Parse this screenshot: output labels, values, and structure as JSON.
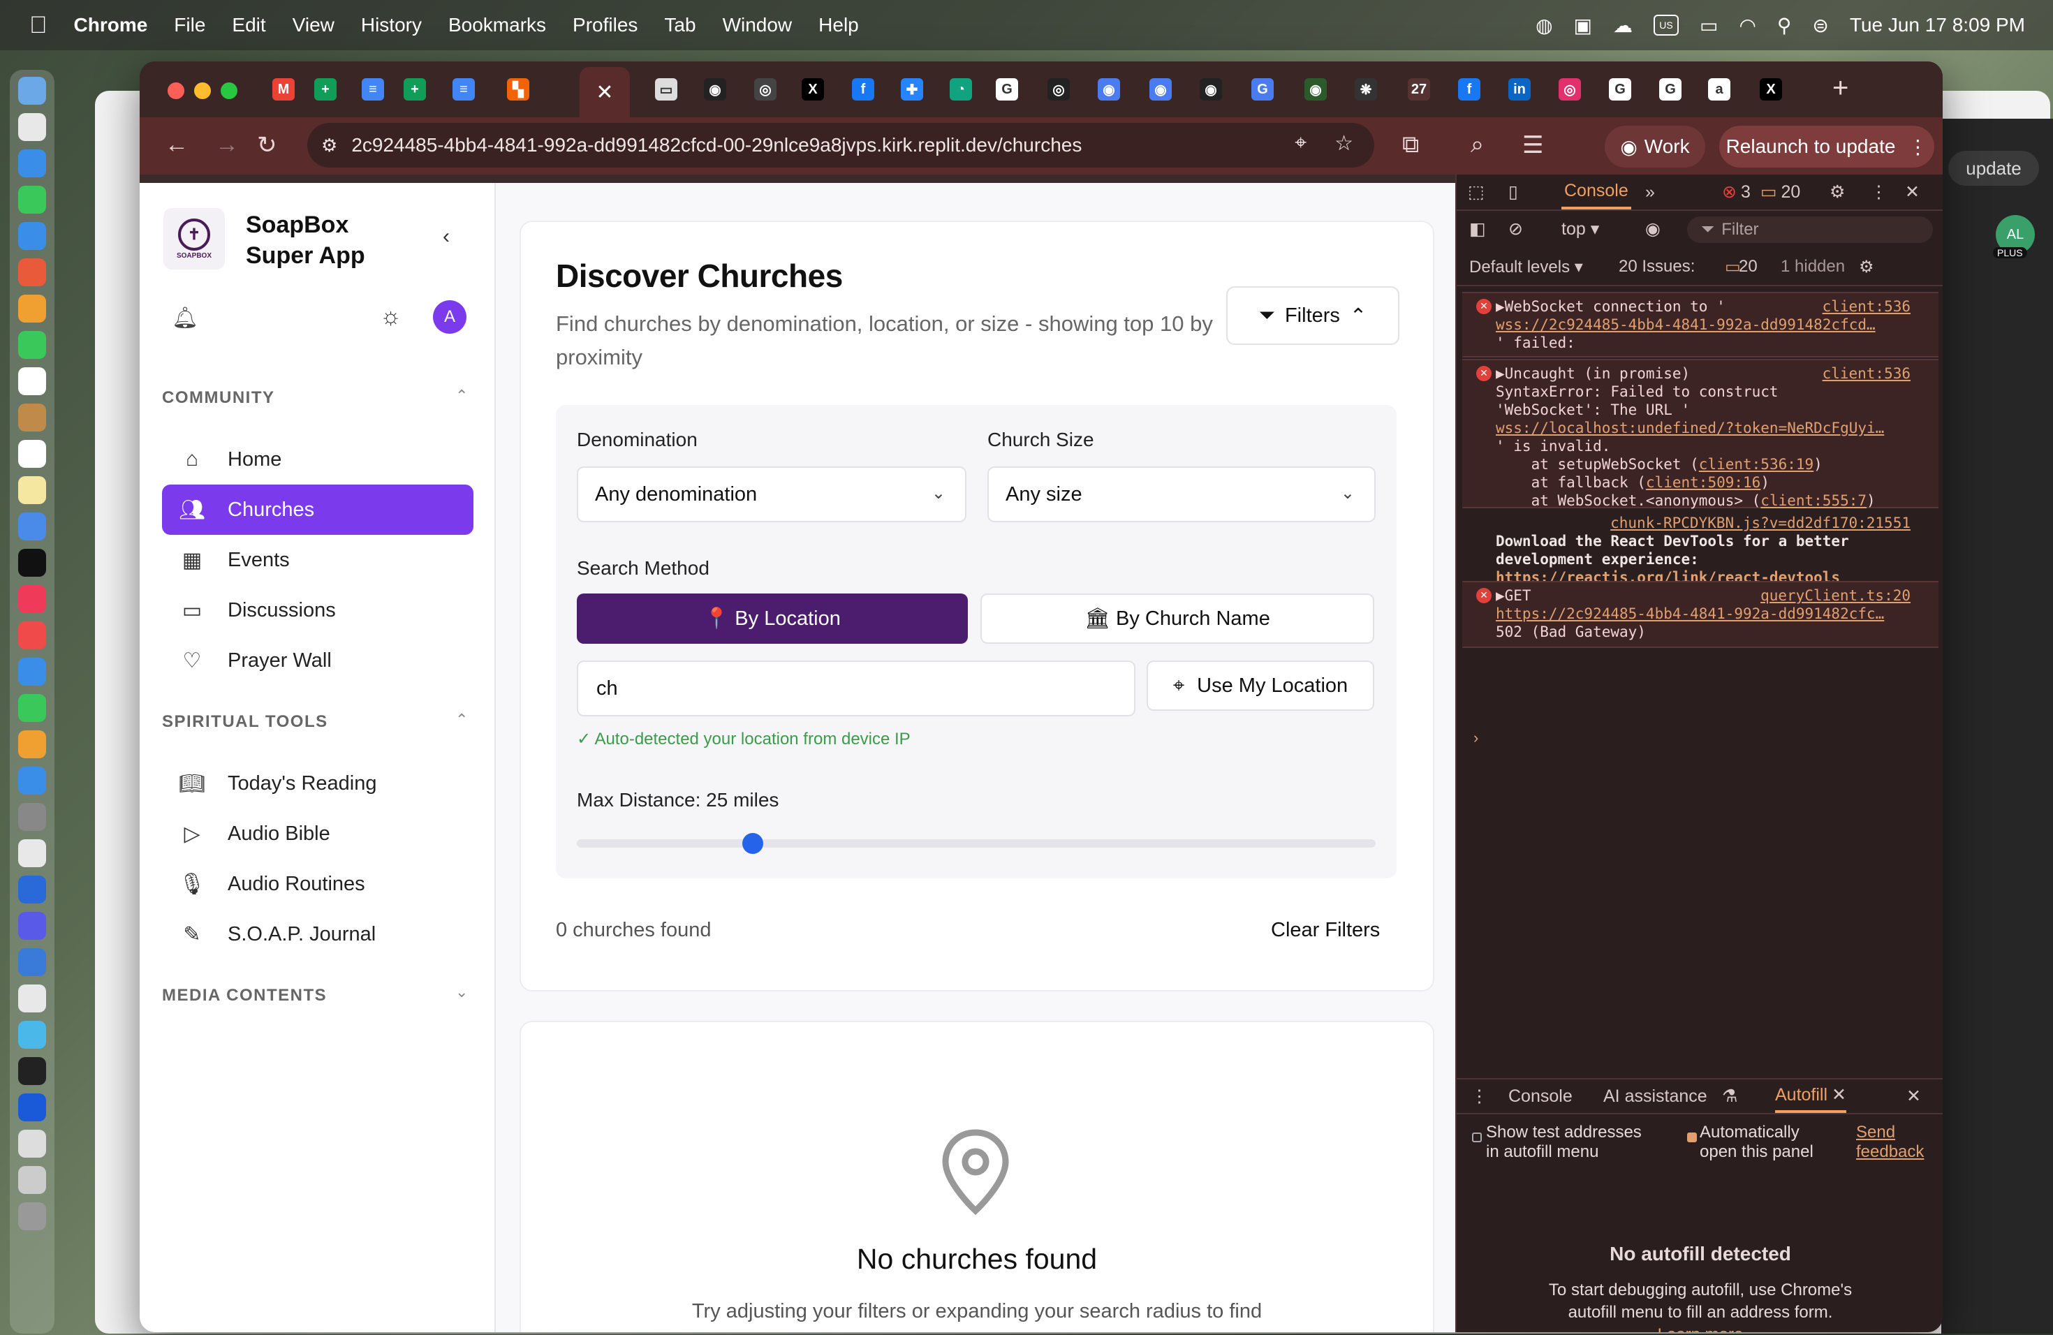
{
  "menubar": {
    "app": "Chrome",
    "items": [
      "File",
      "Edit",
      "View",
      "History",
      "Bookmarks",
      "Profiles",
      "Tab",
      "Window",
      "Help"
    ],
    "input_source": "US",
    "datetime": "Tue Jun 17  8:09 PM"
  },
  "browser": {
    "url": "2c924485-4bb4-4841-992a-dd991482cfcd-00-29nlce9a8jvps.kirk.replit.dev/churches",
    "profile_label": "Work",
    "relaunch_label": "Relaunch to update",
    "active_tab_glyph": "✕",
    "tab_favicons": [
      {
        "glyph": "M",
        "color": "#ea4335"
      },
      {
        "glyph": "+",
        "color": "#0f9d58"
      },
      {
        "glyph": "≡",
        "color": "#4285f4"
      },
      {
        "glyph": "+",
        "color": "#0f9d58"
      },
      {
        "glyph": "≡",
        "color": "#4285f4"
      },
      {
        "glyph": "▚",
        "color": "#f26207"
      },
      {
        "glyph": "▭",
        "color": "#dddddd"
      },
      {
        "glyph": "◉",
        "color": "#222222"
      },
      {
        "glyph": "◎",
        "color": "#444444"
      },
      {
        "glyph": "X",
        "color": "#000000"
      },
      {
        "glyph": "f",
        "color": "#1877f2"
      },
      {
        "glyph": "✚",
        "color": "#2684ff"
      },
      {
        "glyph": "◔",
        "color": "#10a37f"
      },
      {
        "glyph": "G",
        "color": "#ffffff"
      },
      {
        "glyph": "◎",
        "color": "#222222"
      },
      {
        "glyph": "◉",
        "color": "#4a7cf0"
      },
      {
        "glyph": "◉",
        "color": "#4a7cf0"
      },
      {
        "glyph": "◉",
        "color": "#222222"
      },
      {
        "glyph": "G",
        "color": "#4a7cf0"
      },
      {
        "glyph": "◉",
        "color": "#2b5a2b"
      },
      {
        "glyph": "❋",
        "color": "#333333"
      },
      {
        "glyph": "27",
        "color": "#553333"
      },
      {
        "glyph": "f",
        "color": "#1877f2"
      },
      {
        "glyph": "in",
        "color": "#0a66c2"
      },
      {
        "glyph": "◎",
        "color": "#e1306c"
      },
      {
        "glyph": "G",
        "color": "#ffffff"
      },
      {
        "glyph": "G",
        "color": "#ffffff"
      },
      {
        "glyph": "a",
        "color": "#ffffff"
      },
      {
        "glyph": "X",
        "color": "#000000"
      }
    ],
    "bg_window_button": "update",
    "bg_avatar": "AL",
    "bg_avatar_badge": "PLUS"
  },
  "app": {
    "brand_line1": "SoapBox",
    "brand_line2": "Super App",
    "logo_text": "SOAPBOX",
    "avatar_initial": "A",
    "sections": {
      "community": "COMMUNITY",
      "spiritual": "SPIRITUAL TOOLS",
      "media": "MEDIA CONTENTS"
    },
    "community_items": [
      "Home",
      "Churches",
      "Events",
      "Discussions",
      "Prayer Wall"
    ],
    "spiritual_items": [
      "Today's Reading",
      "Audio Bible",
      "Audio Routines",
      "S.O.A.P. Journal"
    ],
    "accent": "#7c3aed"
  },
  "main": {
    "title": "Discover Churches",
    "subtitle": "Find churches by denomination, location, or size - showing top 10 by proximity",
    "filters_label": "Filters",
    "denomination_label": "Denomination",
    "denomination_value": "Any denomination",
    "size_label": "Church Size",
    "size_value": "Any size",
    "search_method_label": "Search Method",
    "by_location": "📍 By Location",
    "by_name": "🏛 By Church Name",
    "location_input_value": "ch",
    "use_my_location": "Use My Location",
    "auto_note": "✓ Auto-detected your location from device IP",
    "max_distance_label": "Max Distance: 25 miles",
    "max_distance_fraction": 0.22,
    "count_text": "0 churches found",
    "clear_filters": "Clear Filters",
    "empty_title": "No churches found",
    "empty_sub": "Try adjusting your filters or expanding your search radius to find"
  },
  "devtools": {
    "tab_console": "Console",
    "error_count": "3",
    "issue_count": "20",
    "context": "top ▾",
    "filter_placeholder": "Filter",
    "levels": "Default levels ▾",
    "issues_label": "20 Issues:",
    "issues_badge": "20",
    "hidden": "1 hidden",
    "m1_line1": "▶WebSocket connection to '",
    "m1_src": "client:536",
    "m1_line2": "wss://2c924485-4bb4-4841-992a-dd991482cfcd…",
    "m1_line3": "' failed:",
    "m2_line1": "▶Uncaught (in promise)",
    "m2_src": "client:536",
    "m2_line2": "SyntaxError: Failed to construct",
    "m2_line3": "'WebSocket': The URL '",
    "m2_line4": "wss://localhost:undefined/?token=NeRDcFgUyi…",
    "m2_line5": "' is invalid.",
    "m2_line6a": "    at setupWebSocket (",
    "m2_line6b": "client:536:19",
    "m2_line7a": "    at fallback (",
    "m2_line7b": "client:509:16",
    "m2_line8a": "    at WebSocket.<anonymous> (",
    "m2_line8b": "client:555:7",
    "m3_src": "chunk-RPCDYKBN.js?v=dd2df170:21551",
    "m3_line1": "Download the React DevTools for a better",
    "m3_line2": "development experience:",
    "m3_link": "https://reactjs.org/link/react-devtools",
    "m4_line1": "▶GET",
    "m4_src": "queryClient.ts:20",
    "m4_line2": "https://2c924485-4bb4-4841-992a-dd991482cfc…",
    "m4_line3": "502 (Bad Gateway)",
    "prompt": "›",
    "drawer_console": "Console",
    "drawer_ai": "AI assistance",
    "drawer_autofill": "Autofill",
    "opt1_line1": "Show test addresses",
    "opt1_line2": "in autofill menu",
    "opt2_line1": "Automatically",
    "opt2_line2": "open this panel",
    "feedback1": "Send",
    "feedback2": "feedback",
    "empty_title": "No autofill detected",
    "empty_line1": "To start debugging autofill, use Chrome's",
    "empty_line2": "autofill menu to fill an address form.",
    "learn_more": "Learn more"
  }
}
